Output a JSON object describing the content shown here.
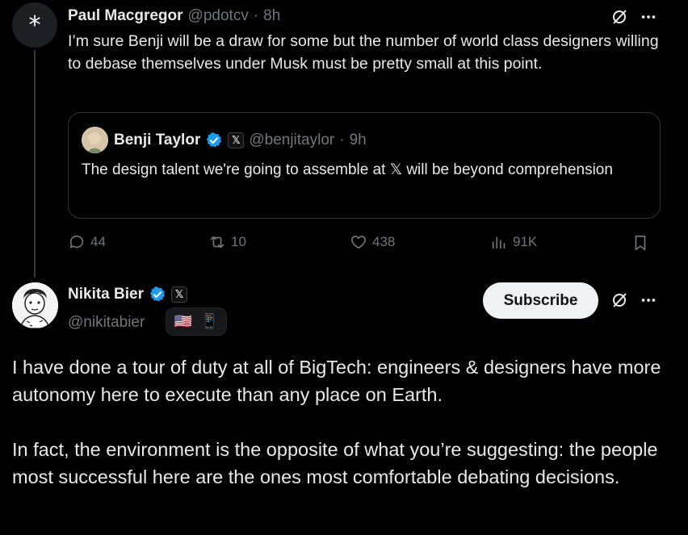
{
  "reply_tweet": {
    "author_name": "Paul Macgregor",
    "author_handle": "@pdotcv",
    "separator": "·",
    "time": "8h",
    "avatar_glyph": "*",
    "text": "I’m sure Benji will be a draw for some but the number of world class designers willing to debase themselves under Musk must be pretty small at this point.",
    "quote": {
      "author_name": "Benji Taylor",
      "author_handle": "@benjitaylor",
      "separator": "·",
      "time": "9h",
      "text": "The design talent we're going to assemble at 𝕏 will be beyond comprehension"
    },
    "actions": {
      "replies": "44",
      "reposts": "10",
      "likes": "438",
      "views": "91K"
    }
  },
  "main_tweet": {
    "author_name": "Nikita Bier",
    "author_handle": "@nikitabier",
    "badge_x": "𝕏",
    "flag_emoji": "🇺🇸",
    "phone_emoji": "📱",
    "subscribe_label": "Subscribe",
    "paragraph1": "I have done a tour of duty at all of BigTech: engineers & designers have more autonomy here to execute than any place on Earth.",
    "paragraph2": "In fact, the environment is the opposite of what you’re suggesting: the people most successful here are the ones most comfortable debating decisions."
  },
  "colors": {
    "background": "#000000",
    "text": "#e7e9ea",
    "muted": "#71767b",
    "border": "#2f3336",
    "verified": "#1d9bf0"
  },
  "icons": [
    "grok-icon",
    "more-icon",
    "reply-icon",
    "repost-icon",
    "like-icon",
    "views-icon",
    "bookmark-icon",
    "verified-badge-icon"
  ]
}
